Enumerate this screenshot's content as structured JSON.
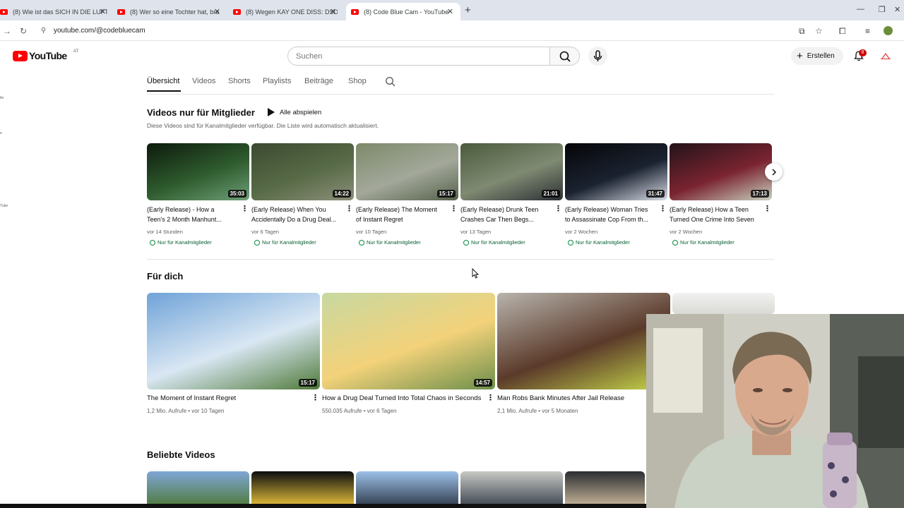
{
  "browser": {
    "tabs": [
      {
        "title": "(8) Wie ist das SICH IN DIE LUFT",
        "active": false
      },
      {
        "title": "(8) Wer so eine Tochter hat, bra",
        "active": false
      },
      {
        "title": "(8) Wegen KAY ONE DISS: DSDS",
        "active": false
      },
      {
        "title": "(8) Code Blue Cam - YouTube",
        "active": true
      }
    ],
    "url": "youtube.com/@codebluecam"
  },
  "header": {
    "logo_text": "YouTube",
    "country": "AT",
    "search_placeholder": "Suchen",
    "create_label": "Erstellen",
    "notifications_count": "8"
  },
  "channel_tabs": [
    "Übersicht",
    "Videos",
    "Shorts",
    "Playlists",
    "Beiträge",
    "Shop"
  ],
  "sidebar_slivers": [
    "ite",
    "e",
    "Tube"
  ],
  "members_section": {
    "title": "Videos nur für Mitglieder",
    "play_all": "Alle abspielen",
    "subtitle": "Diese Videos sind für Kanalmitglieder verfügbar. Die Liste wird automatisch aktualisiert.",
    "badge_label": "Nur für Kanalmitglieder",
    "videos": [
      {
        "title_line1": "(Early Release) - How a",
        "title_line2": "Teen's 2 Month Manhunt...",
        "duration": "35:03",
        "age": "vor 14 Stunden",
        "colors": [
          "#0c1a0c",
          "#2f5c2e",
          "#6e9f78"
        ]
      },
      {
        "title_line1": "(Early Release) When You",
        "title_line2": "Accidentally Do a Drug Deal...",
        "duration": "14:22",
        "age": "vor 6 Tagen",
        "colors": [
          "#3c4a30",
          "#586b47",
          "#8c8f7a"
        ]
      },
      {
        "title_line1": "(Early Release) The Moment",
        "title_line2": "of Instant Regret",
        "duration": "15:17",
        "age": "vor 10 Tagen",
        "colors": [
          "#7d8a6a",
          "#a3a89a",
          "#55614b"
        ]
      },
      {
        "title_line1": "(Early Release) Drunk Teen",
        "title_line2": "Crashes Car Then Begs...",
        "duration": "21:01",
        "age": "vor 13 Tagen",
        "colors": [
          "#4b5a3c",
          "#7f8a72",
          "#2c2f35"
        ]
      },
      {
        "title_line1": "(Early Release) Woman Tries",
        "title_line2": "to Assassinate Cop From th...",
        "duration": "31:47",
        "age": "vor 2 Wochen",
        "colors": [
          "#050608",
          "#1b2230",
          "#d8dde6"
        ]
      },
      {
        "title_line1": "(Early Release) How a Teen",
        "title_line2": "Turned One Crime Into Seven",
        "duration": "17:13",
        "age": "vor 2 Wochen",
        "colors": [
          "#23131a",
          "#7a2430",
          "#c9d3c0"
        ]
      }
    ]
  },
  "for_you": {
    "title": "Für dich",
    "videos": [
      {
        "title": "The Moment of Instant Regret",
        "duration": "15:17",
        "views": "1,2 Mio. Aufrufe",
        "age": "vor 10 Tagen",
        "colors": [
          "#6fa3d8",
          "#d9e7f3",
          "#4f7a3a"
        ]
      },
      {
        "title": "How a Drug Deal Turned Into Total Chaos in Seconds",
        "duration": "14:57",
        "views": "550.035 Aufrufe",
        "age": "vor 6 Tagen",
        "colors": [
          "#c8d8a0",
          "#f3d27a",
          "#6d8f4a"
        ]
      },
      {
        "title": "Man Robs Bank Minutes After Jail Release",
        "duration": "",
        "views": "2,1 Mio. Aufrufe",
        "age": "vor 5 Monaten",
        "colors": [
          "#b8b4ad",
          "#5b3a2a",
          "#c7d94a"
        ]
      }
    ]
  },
  "popular": {
    "title": "Beliebte Videos",
    "thumb_colors": [
      [
        "#7fa6d6",
        "#4f7a3a"
      ],
      [
        "#0b0d10",
        "#e8c23a"
      ],
      [
        "#9cc0e8",
        "#2f3b4c"
      ],
      [
        "#c7c9c4",
        "#3c4450"
      ],
      [
        "#2a2d30",
        "#c9b79c"
      ]
    ]
  }
}
